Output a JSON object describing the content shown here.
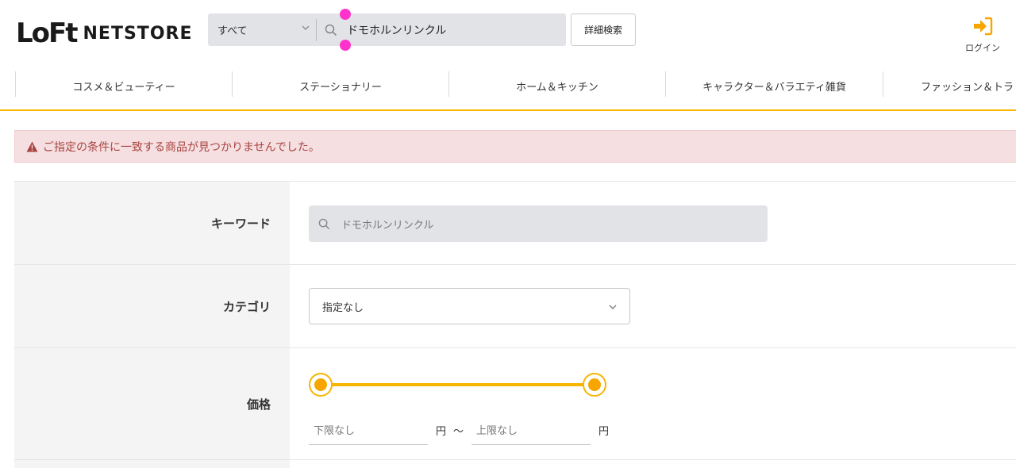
{
  "header": {
    "logo_main": "LoFt",
    "logo_sub": "NETSTORE",
    "search_scope": "すべて",
    "search_query": "ドモホルンリンクル",
    "advanced_search_label": "詳細検索",
    "login_label": "ログイン"
  },
  "nav": {
    "items": [
      {
        "label": "コスメ＆ビューティー"
      },
      {
        "label": "ステーショナリー"
      },
      {
        "label": "ホーム＆キッチン"
      },
      {
        "label": "キャラクター＆バラエティ雑貨"
      },
      {
        "label": "ファッション＆トラ"
      }
    ]
  },
  "alert": {
    "message": "ご指定の条件に一致する商品が見つかりませんでした。"
  },
  "form": {
    "keyword_label": "キーワード",
    "keyword_value": "ドモホルンリンクル",
    "category_label": "カテゴリ",
    "category_value": "指定なし",
    "price_label": "価格",
    "price_min_placeholder": "下限なし",
    "price_max_placeholder": "上限なし",
    "price_unit": "円",
    "price_range_sep": "〜"
  },
  "colors": {
    "accent": "#f7b500",
    "alert_bg": "#f5dfe0",
    "alert_text": "#a94442",
    "login_arrow": "#f7a600"
  }
}
